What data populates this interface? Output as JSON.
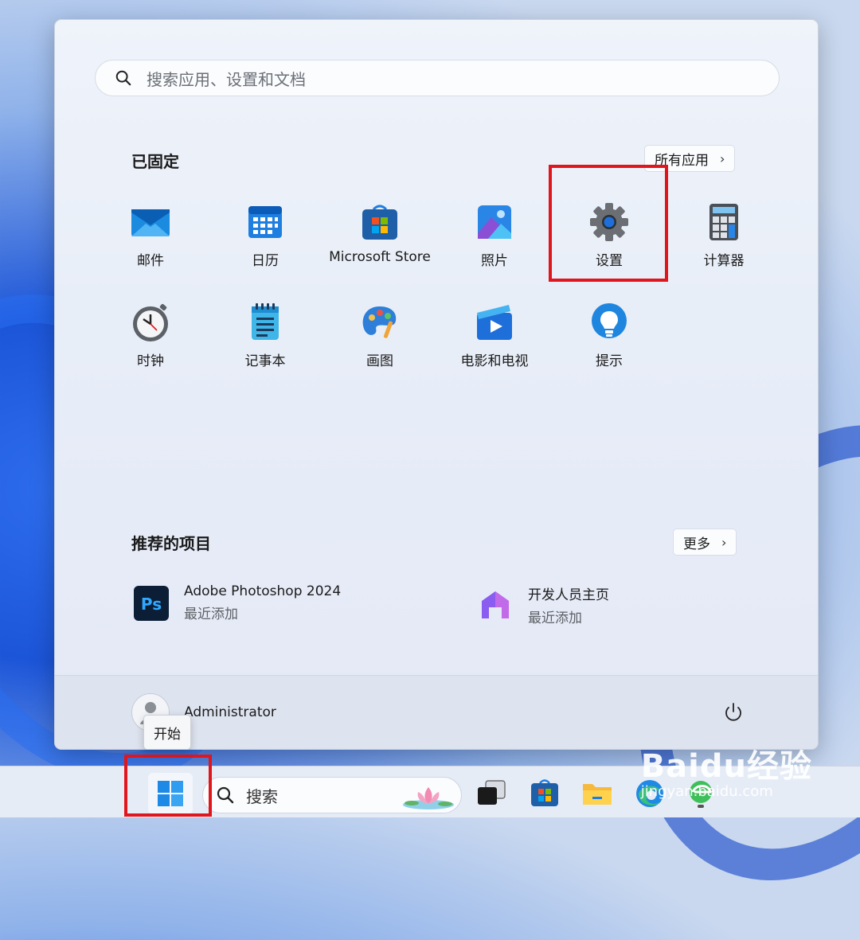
{
  "search": {
    "placeholder": "搜索应用、设置和文档"
  },
  "pinned": {
    "title": "已固定",
    "all_apps_label": "所有应用",
    "apps": [
      {
        "label": "邮件",
        "icon": "mail-icon"
      },
      {
        "label": "日历",
        "icon": "calendar-icon"
      },
      {
        "label": "Microsoft Store",
        "icon": "store-icon"
      },
      {
        "label": "照片",
        "icon": "photos-icon"
      },
      {
        "label": "设置",
        "icon": "gear-icon"
      },
      {
        "label": "计算器",
        "icon": "calculator-icon"
      },
      {
        "label": "时钟",
        "icon": "clock-icon"
      },
      {
        "label": "记事本",
        "icon": "notepad-icon"
      },
      {
        "label": "画图",
        "icon": "paint-icon"
      },
      {
        "label": "电影和电视",
        "icon": "movies-icon"
      },
      {
        "label": "提示",
        "icon": "tips-icon"
      }
    ]
  },
  "recommended": {
    "title": "推荐的项目",
    "more_label": "更多",
    "items": [
      {
        "name": "Adobe Photoshop 2024",
        "sub": "最近添加",
        "icon": "photoshop-icon"
      },
      {
        "name": "开发人员主页",
        "sub": "最近添加",
        "icon": "dev-home-icon"
      }
    ]
  },
  "user": {
    "name": "Administrator"
  },
  "tooltip": "开始",
  "taskbar": {
    "search_label": "搜索"
  },
  "watermark": {
    "line1": "Baidu经验",
    "line2": "jingyan.baidu.com"
  },
  "colors": {
    "highlight": "#e0161c",
    "accent": "#0067c0"
  }
}
